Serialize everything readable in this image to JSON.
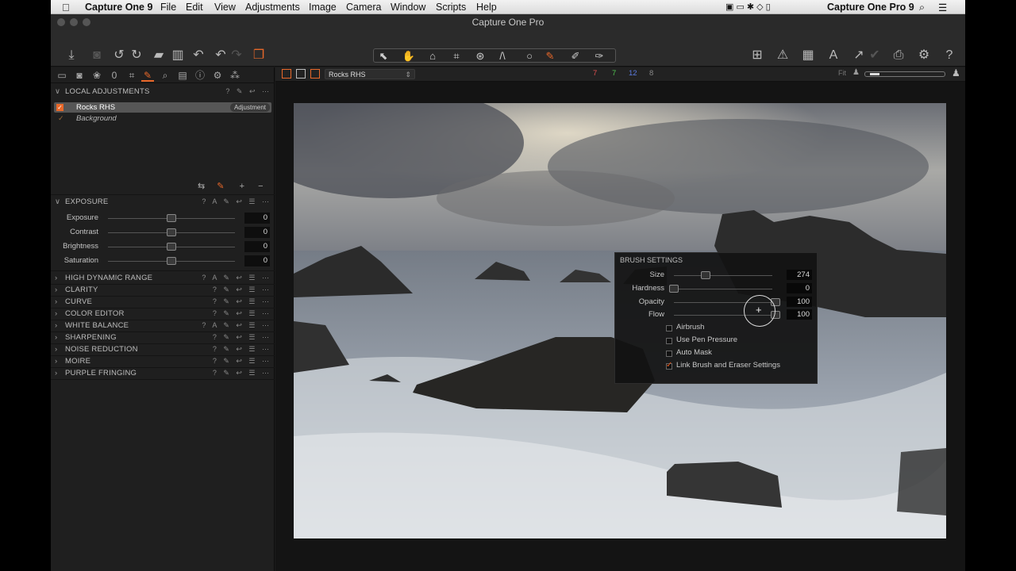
{
  "menubar": {
    "app": "Capture One 9",
    "items": [
      "File",
      "Edit",
      "View",
      "Adjustments",
      "Image",
      "Camera",
      "Window",
      "Scripts",
      "Help"
    ],
    "right_app": "Capture One Pro 9"
  },
  "window": {
    "title": "Capture One Pro"
  },
  "layers": {
    "header": "LOCAL ADJUSTMENTS",
    "items": [
      {
        "name": "Rocks RHS",
        "badge": "Adjustment",
        "checked": true
      },
      {
        "name": "Background",
        "checked": false
      }
    ]
  },
  "exposure": {
    "header": "EXPOSURE",
    "sliders": [
      {
        "label": "Exposure",
        "value": "0"
      },
      {
        "label": "Contrast",
        "value": "0"
      },
      {
        "label": "Brightness",
        "value": "0"
      },
      {
        "label": "Saturation",
        "value": "0"
      }
    ]
  },
  "sections": [
    "HIGH DYNAMIC RANGE",
    "CLARITY",
    "CURVE",
    "COLOR EDITOR",
    "WHITE BALANCE",
    "SHARPENING",
    "NOISE REDUCTION",
    "MOIRE",
    "PURPLE FRINGING"
  ],
  "viewer": {
    "layer_select": "Rocks RHS",
    "counts": [
      "7",
      "7",
      "12",
      "8"
    ],
    "count_colors": [
      "#e05050",
      "#4fc24f",
      "#5b7be0",
      "#888888"
    ],
    "fit": "Fit"
  },
  "brush": {
    "header": "BRUSH SETTINGS",
    "sliders": [
      {
        "label": "Size",
        "value": "274"
      },
      {
        "label": "Hardness",
        "value": "0"
      },
      {
        "label": "Opacity",
        "value": "100"
      },
      {
        "label": "Flow",
        "value": "100"
      }
    ],
    "options": [
      {
        "label": "Airbrush",
        "checked": false
      },
      {
        "label": "Use Pen Pressure",
        "checked": false
      },
      {
        "label": "Auto Mask",
        "checked": false
      },
      {
        "label": "Link Brush and Eraser Settings",
        "checked": true
      }
    ]
  },
  "accent": "#e8682a"
}
